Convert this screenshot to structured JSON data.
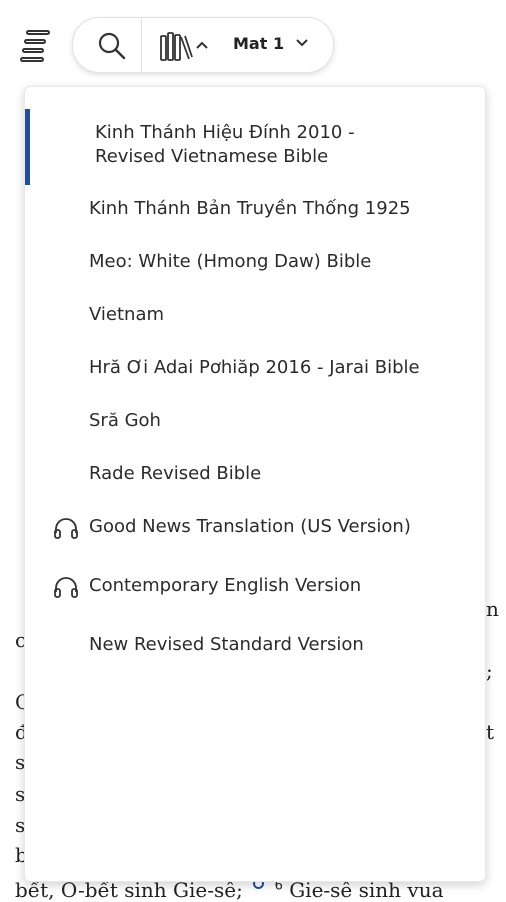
{
  "header": {
    "book_ref": "Mat 1",
    "caret_up": "^",
    "caret_down": "v"
  },
  "versions": [
    {
      "label_line1": "Kinh Thánh Hiệu Đính 2010 -",
      "label_line2": "Revised Vietnamese Bible",
      "selected": true,
      "audio": false
    },
    {
      "label": "Kinh Thánh Bản Truyền Thống 1925",
      "audio": false
    },
    {
      "label": "Meo: White (Hmong Daw) Bible",
      "audio": false
    },
    {
      "label": "Vietnam",
      "audio": false
    },
    {
      "label": "Hră Ơi Adai Pơhiăp 2016 - Jarai Bible",
      "audio": false
    },
    {
      "label": "Sră Goh",
      "audio": false
    },
    {
      "label": "Rade Revised Bible",
      "audio": false
    },
    {
      "label": "Good News Translation (US Version)",
      "audio": true
    },
    {
      "label": "Contemporary English Version",
      "audio": true
    },
    {
      "label": "New Revised Standard Version",
      "audio": false
    }
  ],
  "background_text": {
    "bottom_line": "bết, Ô-bết sinh Gie-sê;",
    "verse_number": "6",
    "bottom_line_cont": "Gie-sê sinh vua",
    "left_fragments": [
      "c",
      "C",
      "đ",
      "s",
      "s",
      "s",
      "b"
    ],
    "right_fragments": [
      "n",
      ";",
      "t"
    ]
  },
  "icons": {
    "menu": "menu-icon",
    "search": "search-icon",
    "library": "library-icon",
    "audio": "headphones-icon"
  },
  "colors": {
    "selection_bar": "#1f4f9a"
  }
}
